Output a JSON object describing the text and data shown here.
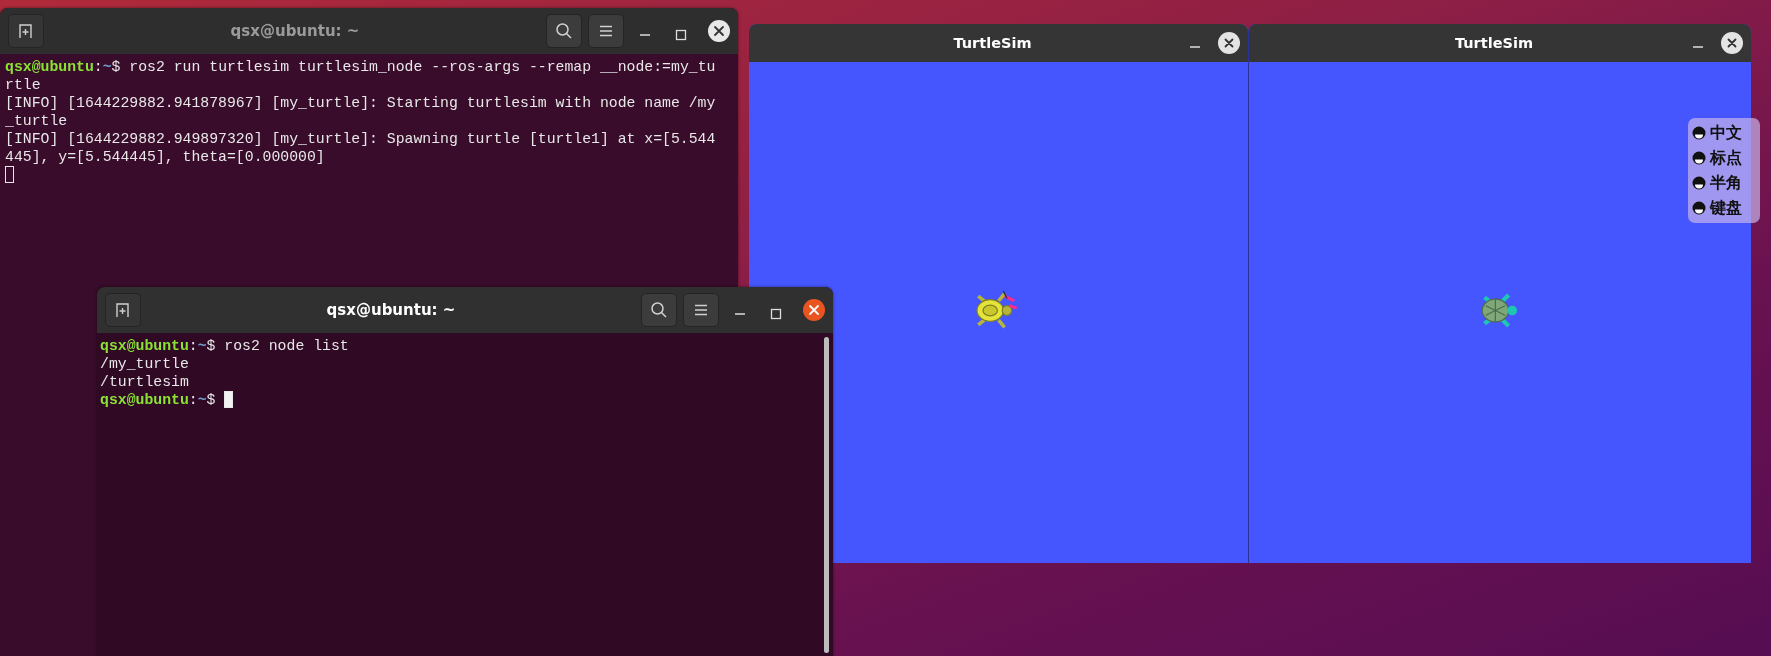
{
  "terminals": [
    {
      "title": "qsx@ubuntu: ~",
      "focused": false,
      "lines": [
        {
          "kind": "prompt",
          "user": "qsx@ubuntu",
          "separator": ":",
          "path": "~",
          "sign": "$",
          "command": "ros2 run turtlesim turtlesim_node --ros-args --remap __node:=my_turtle"
        },
        {
          "kind": "output",
          "text": "[INFO] [1644229882.941878967] [my_turtle]: Starting turtlesim with node name /my_turtle"
        },
        {
          "kind": "output",
          "text": "[INFO] [1644229882.949897320] [my_turtle]: Spawning turtle [turtle1] at x=[5.544445], y=[5.544445], theta=[0.000000]"
        },
        {
          "kind": "blank",
          "cursor": true
        }
      ]
    },
    {
      "title": "qsx@ubuntu: ~",
      "focused": true,
      "lines": [
        {
          "kind": "prompt",
          "user": "qsx@ubuntu",
          "separator": ":",
          "path": "~",
          "sign": "$",
          "command": "ros2 node list"
        },
        {
          "kind": "output",
          "text": "/my_turtle"
        },
        {
          "kind": "output",
          "text": "/turtlesim"
        },
        {
          "kind": "prompt",
          "user": "qsx@ubuntu",
          "separator": ":",
          "path": "~",
          "sign": "$",
          "cursor": true
        }
      ]
    }
  ],
  "turtlesim_windows": [
    {
      "title": "TurtleSim"
    },
    {
      "title": "TurtleSim"
    }
  ],
  "input_method_panel": {
    "items": [
      {
        "label": "中文"
      },
      {
        "label": "标点"
      },
      {
        "label": "半角"
      },
      {
        "label": "键盘"
      }
    ]
  }
}
